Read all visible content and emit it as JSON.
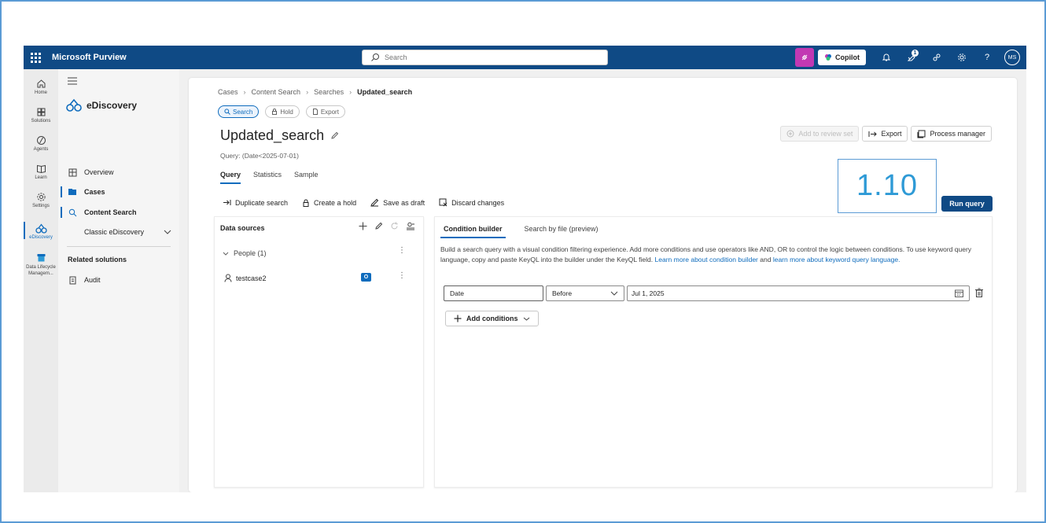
{
  "app": {
    "name": "Microsoft Purview"
  },
  "topbar": {
    "search_placeholder": "Search",
    "copilot_label": "Copilot",
    "notification_count": "1",
    "avatar_initials": "MS"
  },
  "rail": {
    "items": [
      {
        "label": "Home",
        "icon": "home-icon"
      },
      {
        "label": "Solutions",
        "icon": "solutions-icon"
      },
      {
        "label": "Agents",
        "icon": "agents-icon"
      },
      {
        "label": "Learn",
        "icon": "learn-icon"
      },
      {
        "label": "Settings",
        "icon": "settings-icon"
      },
      {
        "label": "eDiscovery",
        "icon": "ediscovery-icon",
        "active": true
      },
      {
        "label": "Data Lifecycle Managem...",
        "icon": "data-lifecycle-icon"
      }
    ]
  },
  "nav": {
    "title": "eDiscovery",
    "items": [
      {
        "label": "Overview"
      },
      {
        "label": "Cases"
      },
      {
        "label": "Content Search"
      },
      {
        "label": "Classic eDiscovery"
      }
    ],
    "related_heading": "Related solutions",
    "related_items": [
      {
        "label": "Audit"
      }
    ]
  },
  "breadcrumb": {
    "items": [
      "Cases",
      "Content Search",
      "Searches"
    ],
    "current": "Updated_search"
  },
  "pills": [
    {
      "label": "Search",
      "selected": true
    },
    {
      "label": "Hold",
      "selected": false
    },
    {
      "label": "Export",
      "selected": false
    }
  ],
  "page": {
    "title": "Updated_search",
    "query_text": "Query: (Date<2025-07-01)",
    "tabs": [
      "Query",
      "Statistics",
      "Sample"
    ],
    "version": "1.10"
  },
  "header_actions": {
    "add_to_review_set": "Add to review set",
    "export": "Export",
    "process_manager": "Process manager",
    "run_query": "Run query"
  },
  "commands": {
    "duplicate": "Duplicate search",
    "create_hold": "Create a hold",
    "save_draft": "Save as draft",
    "discard": "Discard changes"
  },
  "data_sources": {
    "title": "Data sources",
    "group_label": "People (1)",
    "person": "testcase2"
  },
  "condition_builder": {
    "tab_builder": "Condition builder",
    "tab_file": "Search by file (preview)",
    "description": "Build a search query with a visual condition filtering experience. Add more conditions and use operators like AND, OR to control the logic between conditions. To use keyword query language, copy and paste KeyQL into the builder under the KeyQL field.",
    "link_builder": "Learn more about condition builder",
    "and_text": "and",
    "link_keyword": "learn more about keyword query language.",
    "condition": {
      "field": "Date",
      "operator": "Before",
      "value": "Jul 1, 2025"
    },
    "add_conditions_label": "Add conditions"
  },
  "colors": {
    "topbar": "#0f4a85",
    "accent": "#0f6cbd",
    "copilot_pink": "#c239b3",
    "version_text": "#2e9ad6"
  }
}
